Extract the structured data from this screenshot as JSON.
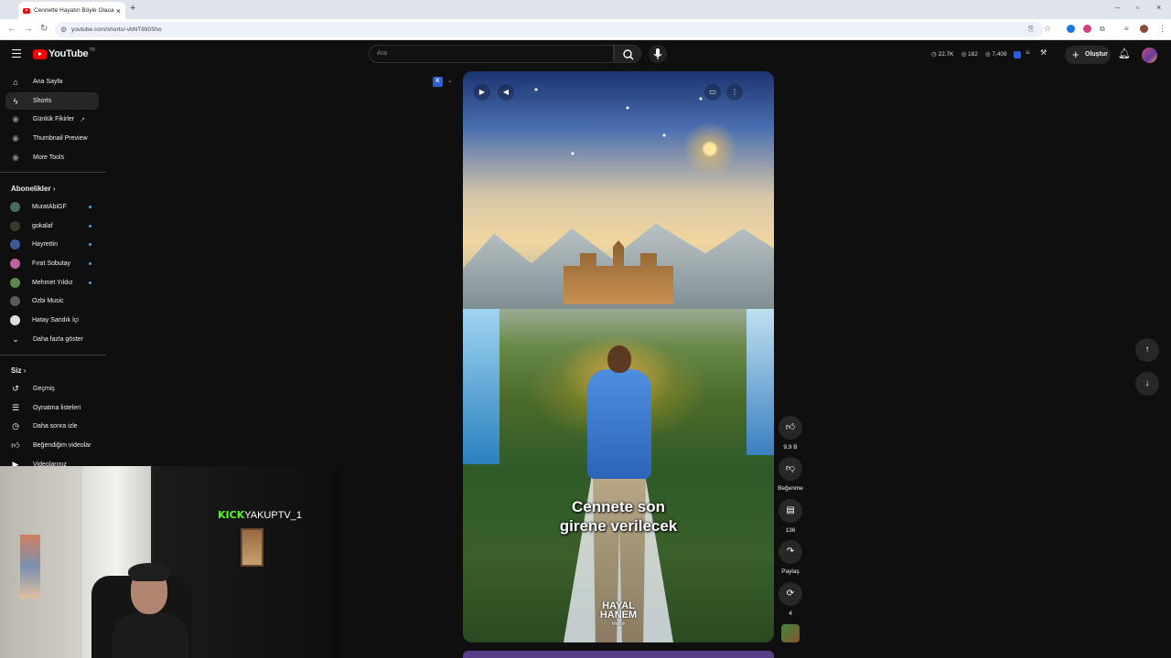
{
  "browser": {
    "tab_title": "Cennette Hayatın Böyle Olacak",
    "url": "youtube.com/shorts/-vbNT890Sho"
  },
  "header": {
    "logo_text": "YouTube",
    "logo_region": "TR",
    "search_placeholder": "Ara",
    "stats": [
      "22.7K",
      "182",
      "7,409"
    ],
    "create_label": "Oluştur"
  },
  "sidebar": {
    "main": [
      {
        "label": "Ana Sayfa",
        "icon": "home-icon"
      },
      {
        "label": "Shorts",
        "icon": "shorts-icon",
        "active": true
      },
      {
        "label": "Günlük Fikirler",
        "icon": "extension-icon"
      },
      {
        "label": "Thumbnail Preview",
        "icon": "extension-icon"
      },
      {
        "label": "More Tools",
        "icon": "extension-icon"
      }
    ],
    "subscriptions_title": "Abonelikler",
    "subscriptions": [
      {
        "label": "MuratAbiGF",
        "color": "#4a6a5a",
        "dot": true
      },
      {
        "label": "gokalaf",
        "color": "#3a3a2a",
        "dot": true
      },
      {
        "label": "Hayrettin",
        "color": "#3a5a9a",
        "dot": true
      },
      {
        "label": "Fırat Sobutay",
        "color": "#c060a0",
        "dot": true
      },
      {
        "label": "Mehmet Yıldız",
        "color": "#5a8a4a",
        "dot": true
      },
      {
        "label": "Ozbi Music",
        "color": "#5a5a5a",
        "dot": false
      },
      {
        "label": "Hatay Sandık İçi",
        "color": "#dddddd",
        "dot": false
      }
    ],
    "show_more": "Daha fazla göster",
    "you_title": "Siz",
    "you": [
      {
        "label": "Geçmiş",
        "icon": "history-icon"
      },
      {
        "label": "Oynatma listeleri",
        "icon": "playlist-icon"
      },
      {
        "label": "Daha sonra izle",
        "icon": "clock-icon"
      },
      {
        "label": "Beğendiğim videolar",
        "icon": "thumbs-up-icon"
      },
      {
        "label": "Videolarınız",
        "icon": "video-icon"
      }
    ]
  },
  "short": {
    "caption_line1": "Cennete son",
    "caption_line2": "girene verilecek",
    "watermark_line1": "HAYAL",
    "watermark_line2": "HANEM",
    "watermark_line3": "Mersin"
  },
  "actions": {
    "like_count": "9,9 B",
    "dislike_label": "Beğenme",
    "comment_count": "136",
    "share_label": "Paylaş",
    "remix_count": "4"
  },
  "overlay": {
    "kick_brand": "KICK",
    "kick_user": "YAKUPTV_1"
  }
}
